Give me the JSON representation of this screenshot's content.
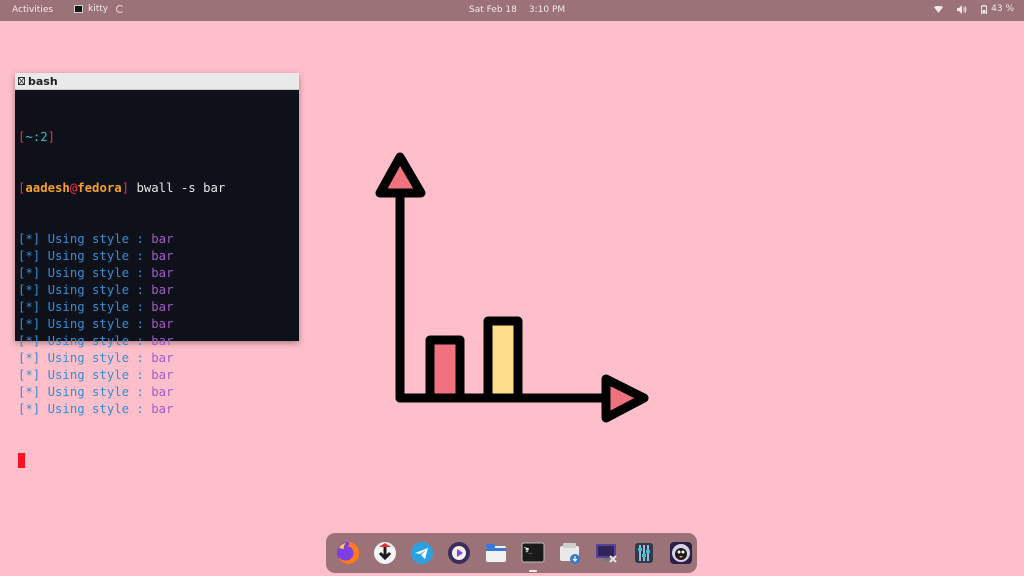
{
  "topbar": {
    "activities": "Activities",
    "app_name": "kitty",
    "date": "Sat Feb 18",
    "time": "3:10 PM",
    "battery": "43 %",
    "icons": [
      "wifi-icon",
      "volume-icon",
      "battery-icon"
    ]
  },
  "terminal": {
    "title": "bash",
    "prompt_dir_open": "[",
    "prompt_dir": "~",
    "prompt_sep": ":",
    "prompt_num": "2",
    "prompt_dir_close": "]",
    "prompt_user": "aadesh",
    "prompt_at": "@",
    "prompt_host": "fedora",
    "command": "bwall -s bar",
    "output_prefix": "[*] Using style : ",
    "output_value": "bar",
    "output_count": 11
  },
  "illustration": {
    "bars": [
      {
        "color": "#f0727e",
        "value": 0.55
      },
      {
        "color": "#fddc8a",
        "value": 0.72
      }
    ],
    "arrow_color": "#f0727e"
  },
  "dock": {
    "apps": [
      {
        "name": "firefox-icon",
        "active": false
      },
      {
        "name": "downloader-icon",
        "active": false
      },
      {
        "name": "telegram-icon",
        "active": false
      },
      {
        "name": "media-player-icon",
        "active": false
      },
      {
        "name": "files-icon",
        "active": false
      },
      {
        "name": "terminal-icon",
        "active": true
      },
      {
        "name": "software-installer-icon",
        "active": false
      },
      {
        "name": "remote-display-icon",
        "active": false
      },
      {
        "name": "equalizer-icon",
        "active": false
      },
      {
        "name": "penguin-icon",
        "active": false
      }
    ]
  },
  "colors": {
    "desktop_bg": "#ffbfca",
    "panel_bg": "#9a7278",
    "terminal_bg": "#0f111a"
  }
}
